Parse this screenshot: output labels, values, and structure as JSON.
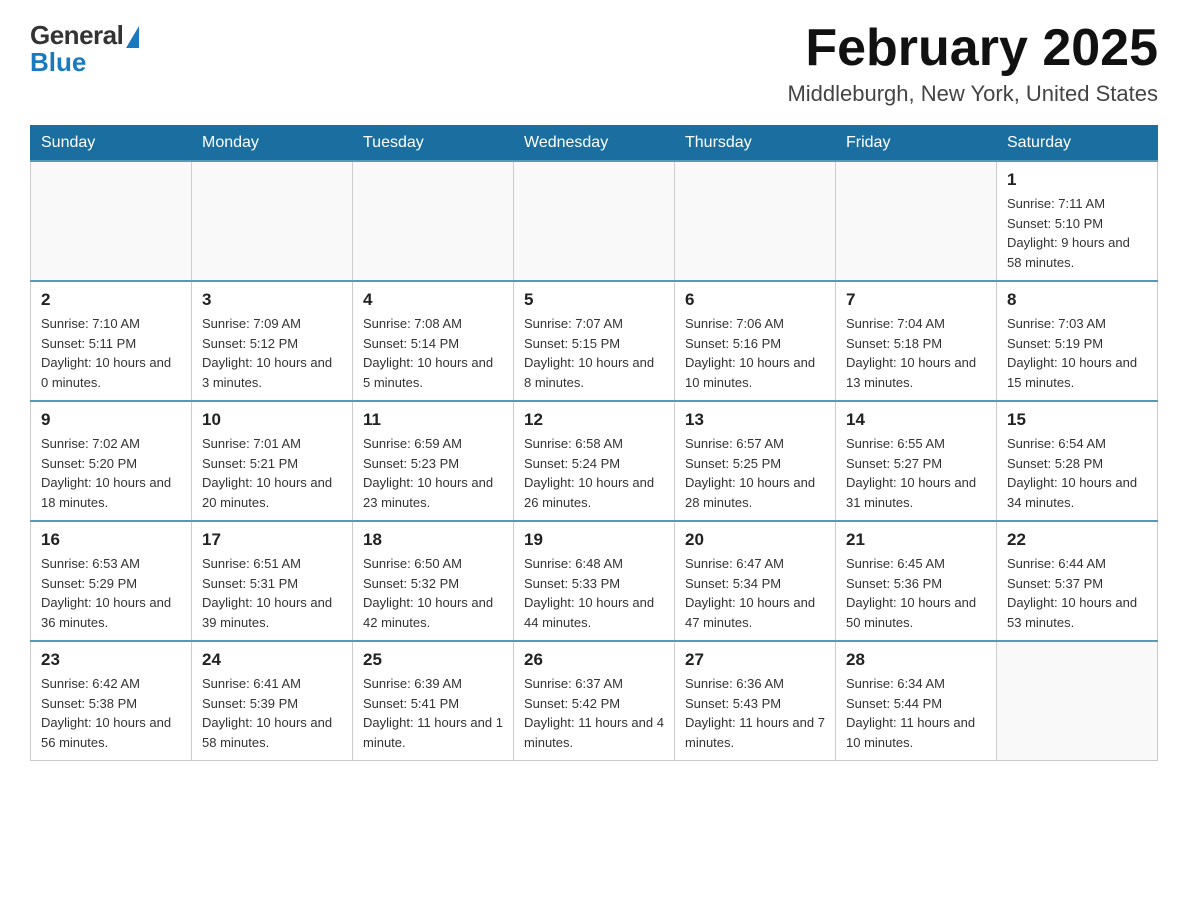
{
  "logo": {
    "general": "General",
    "blue": "Blue"
  },
  "header": {
    "month": "February 2025",
    "location": "Middleburgh, New York, United States"
  },
  "weekdays": [
    "Sunday",
    "Monday",
    "Tuesday",
    "Wednesday",
    "Thursday",
    "Friday",
    "Saturday"
  ],
  "weeks": [
    [
      {
        "day": "",
        "info": ""
      },
      {
        "day": "",
        "info": ""
      },
      {
        "day": "",
        "info": ""
      },
      {
        "day": "",
        "info": ""
      },
      {
        "day": "",
        "info": ""
      },
      {
        "day": "",
        "info": ""
      },
      {
        "day": "1",
        "info": "Sunrise: 7:11 AM\nSunset: 5:10 PM\nDaylight: 9 hours and 58 minutes."
      }
    ],
    [
      {
        "day": "2",
        "info": "Sunrise: 7:10 AM\nSunset: 5:11 PM\nDaylight: 10 hours and 0 minutes."
      },
      {
        "day": "3",
        "info": "Sunrise: 7:09 AM\nSunset: 5:12 PM\nDaylight: 10 hours and 3 minutes."
      },
      {
        "day": "4",
        "info": "Sunrise: 7:08 AM\nSunset: 5:14 PM\nDaylight: 10 hours and 5 minutes."
      },
      {
        "day": "5",
        "info": "Sunrise: 7:07 AM\nSunset: 5:15 PM\nDaylight: 10 hours and 8 minutes."
      },
      {
        "day": "6",
        "info": "Sunrise: 7:06 AM\nSunset: 5:16 PM\nDaylight: 10 hours and 10 minutes."
      },
      {
        "day": "7",
        "info": "Sunrise: 7:04 AM\nSunset: 5:18 PM\nDaylight: 10 hours and 13 minutes."
      },
      {
        "day": "8",
        "info": "Sunrise: 7:03 AM\nSunset: 5:19 PM\nDaylight: 10 hours and 15 minutes."
      }
    ],
    [
      {
        "day": "9",
        "info": "Sunrise: 7:02 AM\nSunset: 5:20 PM\nDaylight: 10 hours and 18 minutes."
      },
      {
        "day": "10",
        "info": "Sunrise: 7:01 AM\nSunset: 5:21 PM\nDaylight: 10 hours and 20 minutes."
      },
      {
        "day": "11",
        "info": "Sunrise: 6:59 AM\nSunset: 5:23 PM\nDaylight: 10 hours and 23 minutes."
      },
      {
        "day": "12",
        "info": "Sunrise: 6:58 AM\nSunset: 5:24 PM\nDaylight: 10 hours and 26 minutes."
      },
      {
        "day": "13",
        "info": "Sunrise: 6:57 AM\nSunset: 5:25 PM\nDaylight: 10 hours and 28 minutes."
      },
      {
        "day": "14",
        "info": "Sunrise: 6:55 AM\nSunset: 5:27 PM\nDaylight: 10 hours and 31 minutes."
      },
      {
        "day": "15",
        "info": "Sunrise: 6:54 AM\nSunset: 5:28 PM\nDaylight: 10 hours and 34 minutes."
      }
    ],
    [
      {
        "day": "16",
        "info": "Sunrise: 6:53 AM\nSunset: 5:29 PM\nDaylight: 10 hours and 36 minutes."
      },
      {
        "day": "17",
        "info": "Sunrise: 6:51 AM\nSunset: 5:31 PM\nDaylight: 10 hours and 39 minutes."
      },
      {
        "day": "18",
        "info": "Sunrise: 6:50 AM\nSunset: 5:32 PM\nDaylight: 10 hours and 42 minutes."
      },
      {
        "day": "19",
        "info": "Sunrise: 6:48 AM\nSunset: 5:33 PM\nDaylight: 10 hours and 44 minutes."
      },
      {
        "day": "20",
        "info": "Sunrise: 6:47 AM\nSunset: 5:34 PM\nDaylight: 10 hours and 47 minutes."
      },
      {
        "day": "21",
        "info": "Sunrise: 6:45 AM\nSunset: 5:36 PM\nDaylight: 10 hours and 50 minutes."
      },
      {
        "day": "22",
        "info": "Sunrise: 6:44 AM\nSunset: 5:37 PM\nDaylight: 10 hours and 53 minutes."
      }
    ],
    [
      {
        "day": "23",
        "info": "Sunrise: 6:42 AM\nSunset: 5:38 PM\nDaylight: 10 hours and 56 minutes."
      },
      {
        "day": "24",
        "info": "Sunrise: 6:41 AM\nSunset: 5:39 PM\nDaylight: 10 hours and 58 minutes."
      },
      {
        "day": "25",
        "info": "Sunrise: 6:39 AM\nSunset: 5:41 PM\nDaylight: 11 hours and 1 minute."
      },
      {
        "day": "26",
        "info": "Sunrise: 6:37 AM\nSunset: 5:42 PM\nDaylight: 11 hours and 4 minutes."
      },
      {
        "day": "27",
        "info": "Sunrise: 6:36 AM\nSunset: 5:43 PM\nDaylight: 11 hours and 7 minutes."
      },
      {
        "day": "28",
        "info": "Sunrise: 6:34 AM\nSunset: 5:44 PM\nDaylight: 11 hours and 10 minutes."
      },
      {
        "day": "",
        "info": ""
      }
    ]
  ]
}
